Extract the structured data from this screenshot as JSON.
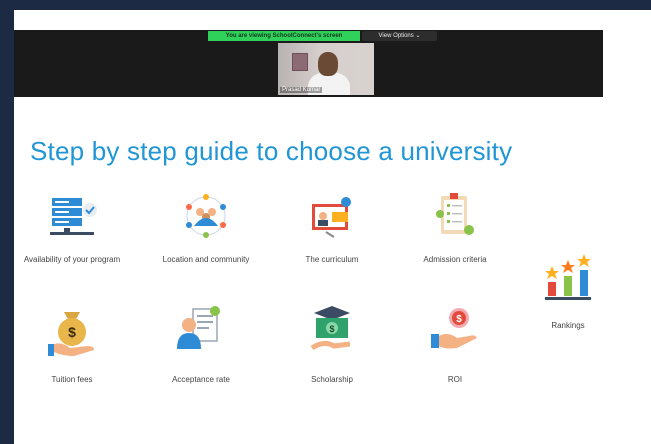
{
  "zoom": {
    "share_banner": "You are viewing SchoolConnect's screen",
    "view_options": "View Options ⌄",
    "participant_name": "Prasad Kumar"
  },
  "slide": {
    "title": "Step by step guide to choose a university",
    "items": [
      {
        "label": "Availability of your program",
        "icon": "server-checklist-icon"
      },
      {
        "label": "Location and community",
        "icon": "community-circle-icon"
      },
      {
        "label": "The curriculum",
        "icon": "curriculum-board-icon"
      },
      {
        "label": "Admission criteria",
        "icon": "clipboard-checklist-icon"
      },
      {
        "label": "Rankings",
        "icon": "bar-chart-stars-icon"
      },
      {
        "label": "Tuition fees",
        "icon": "money-bag-hand-icon"
      },
      {
        "label": "Acceptance rate",
        "icon": "document-person-icon"
      },
      {
        "label": "Scholarship",
        "icon": "graduation-money-icon"
      },
      {
        "label": "ROI",
        "icon": "hand-coin-icon"
      }
    ]
  }
}
